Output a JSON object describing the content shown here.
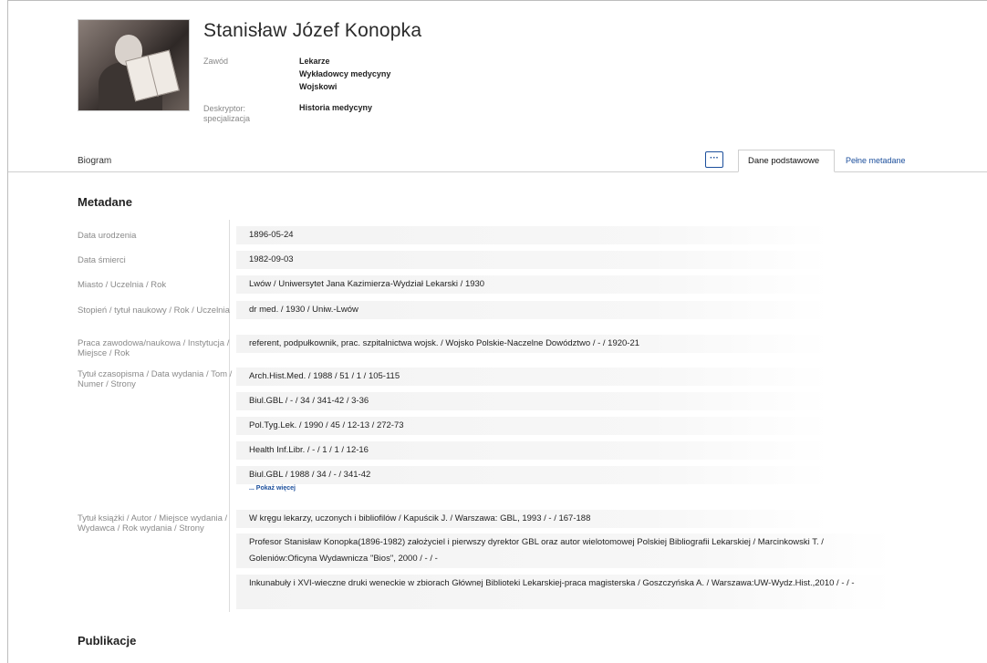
{
  "person": {
    "name": "Stanisław Józef Konopka"
  },
  "header_meta": {
    "zawod_label": "Zawód",
    "zawod_values": [
      "Lekarze",
      "Wykładowcy medycyny",
      "Wojskowi"
    ],
    "descriptor_label": "Deskryptor: specjalizacja",
    "descriptor_value": "Historia medycyny"
  },
  "tabs": {
    "biogram": "Biogram",
    "more": "···",
    "basic": "Dane podstawowe",
    "full": "Pełne metadane"
  },
  "metadata": {
    "title": "Metadane",
    "rows": [
      {
        "label": "Data urodzenia",
        "value": "1896-05-24"
      },
      {
        "label": "Data śmierci",
        "value": "1982-09-03"
      },
      {
        "label": "Miasto / Uczelnia / Rok",
        "value": "Lwów / Uniwersytet Jana Kazimierza-Wydział Lekarski / 1930"
      },
      {
        "label": "Stopień / tytuł naukowy / Rok / Uczelnia",
        "value": "dr med. / 1930 / Uniw.-Lwów"
      },
      {
        "label": "Praca zawodowa/naukowa / Instytucja / Miejsce / Rok",
        "value": "referent, podpułkownik, prac. szpitalnictwa wojsk. / Wojsko Polskie-Naczelne Dowództwo / - / 1920-21"
      }
    ],
    "journal_label": "Tytuł czasopisma / Data wydania / Tom / Numer / Strony",
    "journal_values": [
      "Arch.Hist.Med. / 1988 / 51 / 1 / 105-115",
      "Biul.GBL / - / 34 / 341-42 / 3-36",
      "Pol.Tyg.Lek. / 1990 / 45 / 12-13 / 272-73",
      "Health Inf.Libr. / - / 1 / 1 / 12-16",
      "Biul.GBL / 1988 / 34 / - / 341-42"
    ],
    "show_more": "... Pokaż więcej",
    "book_label": "Tytuł książki / Autor / Miejsce wydania / Wydawca / Rok wydania / Strony",
    "book_values": [
      "W kręgu lekarzy, uczonych i bibliofilów / Kapuścik J. / Warszawa: GBL, 1993 / - / 167-188",
      "Profesor Stanisław Konopka(1896-1982) założyciel i pierwszy dyrektor GBL oraz autor wielotomowej Polskiej Bibliografii Lekarskiej / Marcinkowski T. / Goleniów:Oficyna Wydawnicza \"Bios\", 2000 / - / -",
      "Inkunabuły i XVI-wieczne druki weneckie w zbiorach Głównej Biblioteki Lekarskiej-praca magisterska / Goszczyńska A. / Warszawa:UW-Wydz.Hist.,2010 / - / -"
    ]
  },
  "publikacje": {
    "title": "Publikacje"
  }
}
